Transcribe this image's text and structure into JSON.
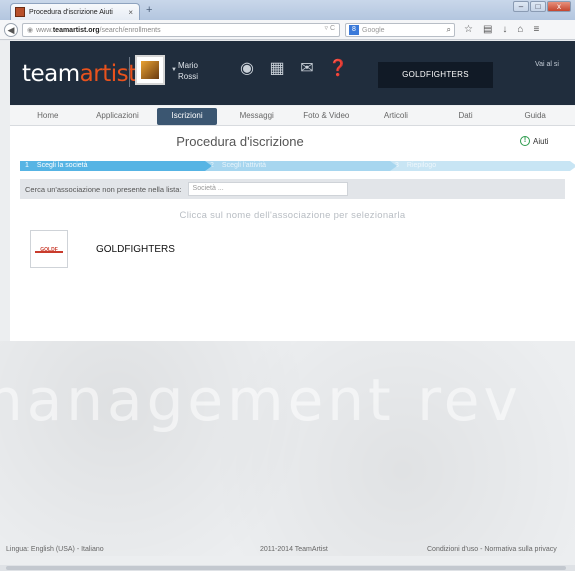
{
  "browser": {
    "tab_title": "Procedura d'iscrizione Aiuti",
    "url_prefix": "www.",
    "url_domain": "teamartist.org",
    "url_path": "/search/enrollments",
    "search_placeholder": "Google",
    "window_buttons": [
      "–",
      "□",
      "x"
    ]
  },
  "header": {
    "logo_main": "team",
    "logo_accent": "artist",
    "user_first": "Mario",
    "user_last": "Rossi",
    "team_name": "GOLDFIGHTERS",
    "goto_label": "Vai al si"
  },
  "menu": [
    {
      "label": "Home",
      "active": false
    },
    {
      "label": "Applicazioni",
      "active": false
    },
    {
      "label": "Iscrizioni",
      "active": true
    },
    {
      "label": "Messaggi",
      "active": false
    },
    {
      "label": "Foto & Video",
      "active": false
    },
    {
      "label": "Articoli",
      "active": false
    },
    {
      "label": "Dati",
      "active": false
    },
    {
      "label": "Guida",
      "active": false
    }
  ],
  "content": {
    "title": "Procedura d'iscrizione",
    "help_label": "Aiuti",
    "steps": [
      {
        "num": "1",
        "label": "Scegli la società"
      },
      {
        "num": "2",
        "label": "Scegli l'attività"
      },
      {
        "num": "3",
        "label": "Riepilogo"
      }
    ],
    "search_label": "Cerca un'associazione non presente nella lista:",
    "search_placeholder": "Società ...",
    "instruction": "Clicca sul nome dell'associazione per selezionarla",
    "associations": [
      {
        "name": "GOLDFIGHTERS",
        "logo_text": "GOLDF"
      }
    ]
  },
  "background_text": "nanagement rev",
  "footer": {
    "language": "Lingua: English (USA) - Italiano",
    "copyright": "2011-2014 TeamArtist",
    "conditions": "Condizioni d'uso - Normativa sulla privacy"
  },
  "colors": {
    "header_bg": "#202d3d",
    "accent": "#e8521d",
    "active_menu": "#3b5671",
    "step_active": "#56b4e4"
  }
}
